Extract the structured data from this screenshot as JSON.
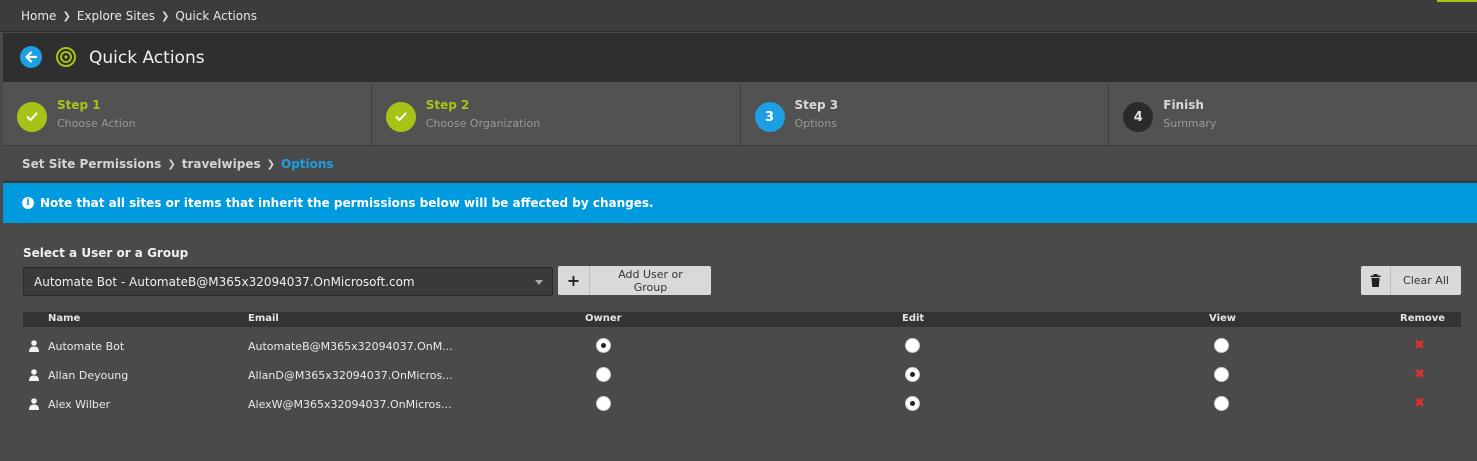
{
  "breadcrumb": [
    "Home",
    "Explore Sites",
    "Quick Actions"
  ],
  "page": {
    "title": "Quick Actions"
  },
  "steps": [
    {
      "title": "Step 1",
      "subtitle": "Choose Action",
      "state": "done",
      "marker": ""
    },
    {
      "title": "Step 2",
      "subtitle": "Choose Organization",
      "state": "done",
      "marker": ""
    },
    {
      "title": "Step 3",
      "subtitle": "Options",
      "state": "current",
      "marker": "3"
    },
    {
      "title": "Finish",
      "subtitle": "Summary",
      "state": "todo",
      "marker": "4"
    }
  ],
  "subcrumb": [
    "Set Site Permissions",
    "travelwipes",
    "Options"
  ],
  "notice": "Note that all sites or items that inherit the permissions below will be affected by changes.",
  "selector": {
    "label": "Select a User or a Group",
    "value": "Automate Bot - AutomateB@M365x32094037.OnMicrosoft.com"
  },
  "buttons": {
    "add": "Add User or Group",
    "clear": "Clear All"
  },
  "table": {
    "headers": {
      "name": "Name",
      "email": "Email",
      "owner": "Owner",
      "edit": "Edit",
      "view": "View",
      "remove": "Remove"
    },
    "rows": [
      {
        "name": "Automate Bot",
        "email": "AutomateB@M365x32094037.OnM...",
        "permission": "owner"
      },
      {
        "name": "Allan Deyoung",
        "email": "AllanD@M365x32094037.OnMicros...",
        "permission": "edit"
      },
      {
        "name": "Alex Wilber",
        "email": "AlexW@M365x32094037.OnMicros...",
        "permission": "edit"
      }
    ]
  },
  "colors": {
    "accent_green": "#a8c318",
    "accent_blue": "#1e9fe3",
    "notice_blue": "#009bde",
    "remove_red": "#e0302b"
  }
}
